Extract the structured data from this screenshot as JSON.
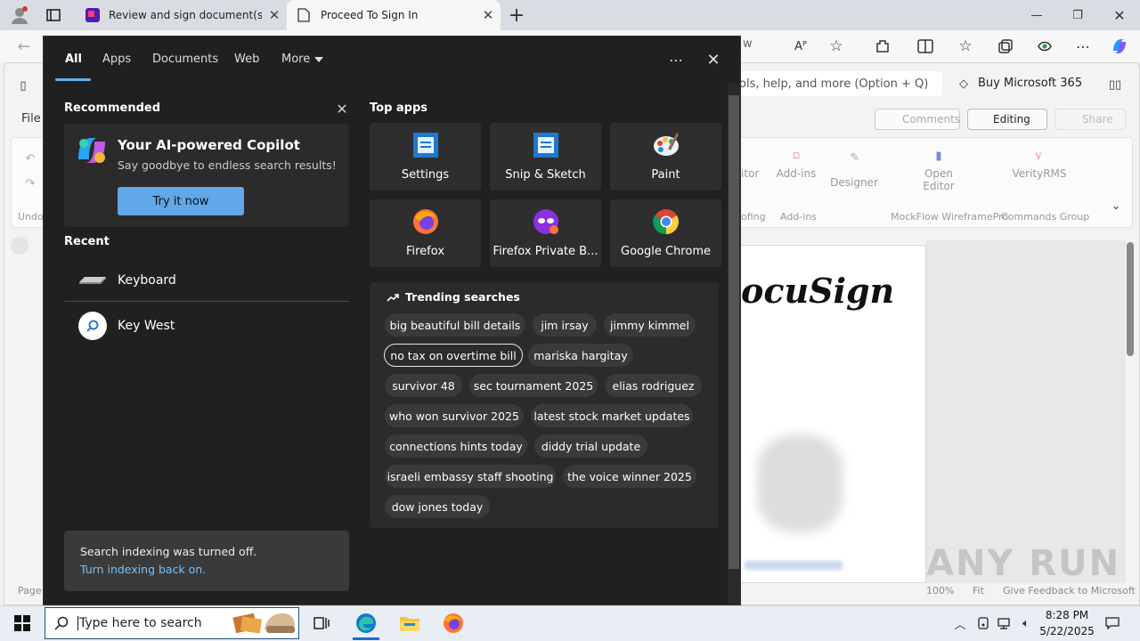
{
  "browser": {
    "tabs": [
      {
        "title": "Review and sign document(s) | D",
        "icon": "docusign-icon"
      },
      {
        "title": "Proceed To Sign In",
        "icon": "page-icon"
      }
    ],
    "address_partial": "w",
    "read_aloud_icon": "Aᴾ"
  },
  "word": {
    "search_placeholder": "ols, help, and more (Option + Q)",
    "buy_label": "Buy Microsoft 365",
    "file_label": "File",
    "comments_label": "Comments",
    "editing_label": "Editing",
    "share_label": "Share",
    "ribbon": {
      "itor": "itor",
      "addins": "Add-ins",
      "designer": "Designer",
      "open_editor": "Open Editor",
      "verity": "VerityRMS",
      "group_proofing": "ofing",
      "group_addins": "Add-ins",
      "group_mockflow": "MockFlow WireframePro",
      "group_commands": "Commands Group",
      "undo_group": "Undo"
    },
    "doc_logo_text": "ocuSign",
    "status": {
      "page": "Page",
      "zoom": "100%",
      "fit": "Fit",
      "feedback": "Give Feedback to Microsoft"
    }
  },
  "search_panel": {
    "tabs": [
      "All",
      "Apps",
      "Documents",
      "Web",
      "More"
    ],
    "recommended_title": "Recommended",
    "copilot": {
      "title": "Your AI-powered Copilot",
      "subtitle": "Say goodbye to endless search results!",
      "button": "Try it now"
    },
    "recent_title": "Recent",
    "recent": [
      "Keyboard",
      "Key West"
    ],
    "indexing": {
      "message": "Search indexing was turned off.",
      "link": "Turn indexing back on."
    },
    "top_apps_title": "Top apps",
    "apps": [
      {
        "label": "Settings",
        "icon": "settings-icon"
      },
      {
        "label": "Snip & Sketch",
        "icon": "snip-sketch-icon"
      },
      {
        "label": "Paint",
        "icon": "paint-icon"
      },
      {
        "label": "Firefox",
        "icon": "firefox-icon"
      },
      {
        "label": "Firefox Private B...",
        "icon": "firefox-private-icon"
      },
      {
        "label": "Google Chrome",
        "icon": "chrome-icon"
      }
    ],
    "trending_title": "Trending searches",
    "trending": [
      "big beautiful bill details",
      "jim irsay",
      "jimmy kimmel",
      "no tax on overtime bill",
      "mariska hargitay",
      "survivor 48",
      "sec tournament 2025",
      "elias rodriguez",
      "who won survivor 2025",
      "latest stock market updates",
      "connections hints today",
      "diddy trial update",
      "israeli embassy staff shooting",
      "the voice winner 2025",
      "dow jones today"
    ]
  },
  "taskbar": {
    "search_placeholder": "Type here to search",
    "time": "8:28 PM",
    "date": "5/22/2025"
  },
  "watermark": "ANY RUN",
  "colors": {
    "accent": "#60b4f0",
    "panel_bg": "#202020",
    "button_blue": "#60a8e8"
  }
}
